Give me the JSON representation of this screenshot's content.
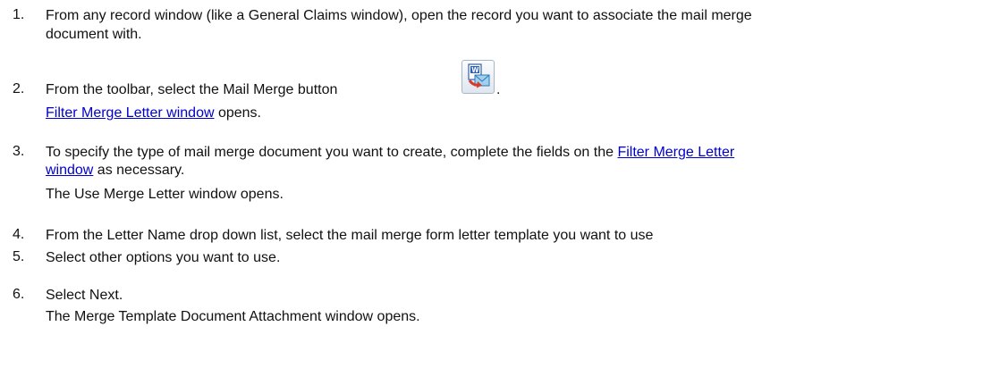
{
  "steps": [
    {
      "number": "1.",
      "line1": "From any record window (like a General Claims window), open the record you want to associate the mail merge",
      "line2": "document with."
    },
    {
      "number": "2.",
      "text_before_icon": "From the toolbar, select the Mail Merge button",
      "text_after_icon": ".",
      "icon": "mail-merge-icon",
      "result_link": "Filter Merge Letter window",
      "result_after": " opens."
    },
    {
      "number": "3.",
      "line1_before_link": "To specify the type of mail merge document you want to create, complete the fields on the ",
      "line1_link": "Filter Merge Letter",
      "line2_link": "window",
      "line2_after": " as necessary.",
      "result": "The Use Merge Letter window opens."
    },
    {
      "number": "4.",
      "line1": "From the Letter Name drop down list, select the mail merge form letter template you want to use"
    },
    {
      "number": "5.",
      "line1": "Select other options you want to use."
    },
    {
      "number": "6.",
      "line1": "Select Next.",
      "result": "The Merge Template Document Attachment window opens."
    }
  ],
  "colors": {
    "link": "#0000cc",
    "text": "#111111"
  }
}
